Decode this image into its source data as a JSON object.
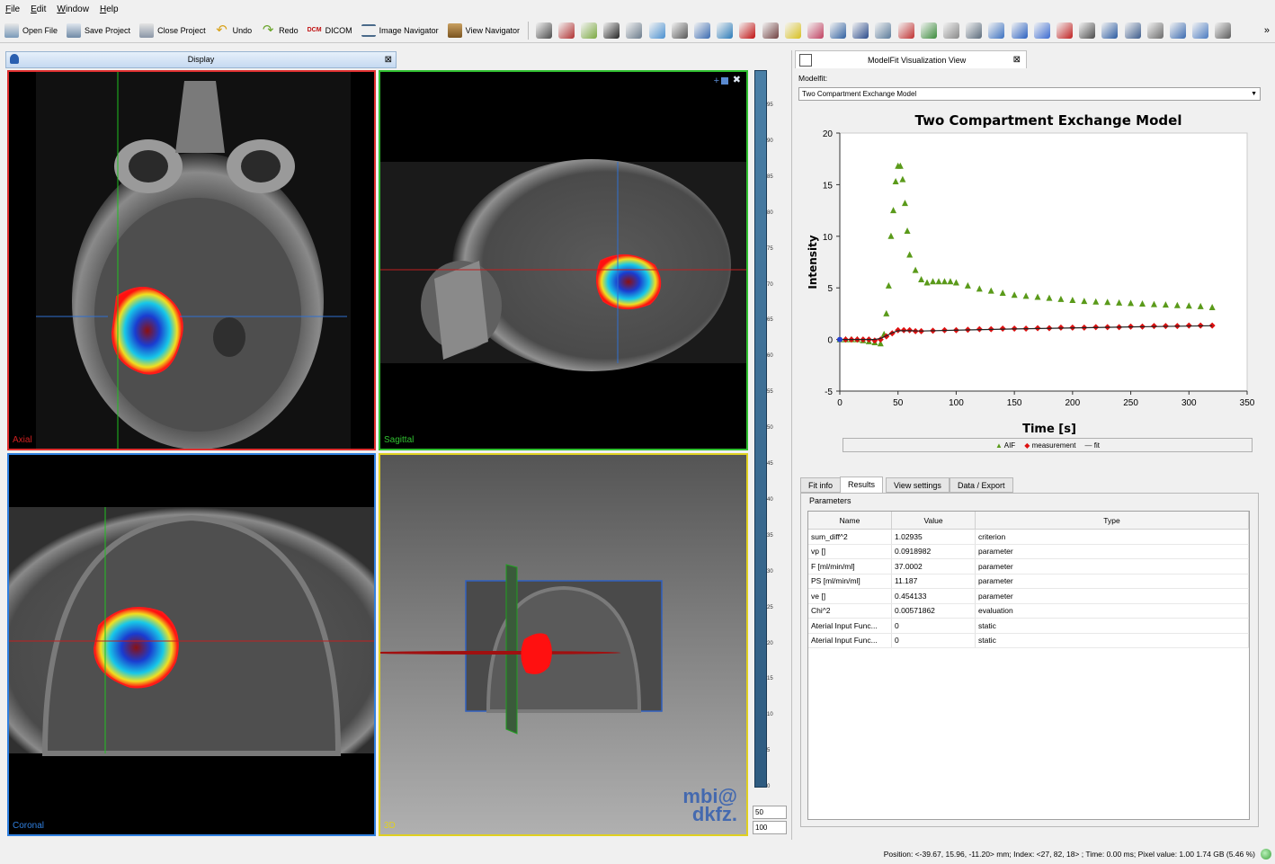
{
  "menubar": [
    "File",
    "Edit",
    "Window",
    "Help"
  ],
  "toolbar": {
    "buttons": [
      {
        "label": "Open File",
        "icon": "open-file-icon"
      },
      {
        "label": "Save Project",
        "icon": "save-project-icon"
      },
      {
        "label": "Close Project",
        "icon": "close-project-icon"
      },
      {
        "label": "Undo",
        "icon": "undo-icon"
      },
      {
        "label": "Redo",
        "icon": "redo-icon"
      },
      {
        "label": "DICOM",
        "icon": "dicom-icon"
      },
      {
        "label": "Image Navigator",
        "icon": "image-navigator-icon"
      },
      {
        "label": "View Navigator",
        "icon": "view-navigator-icon"
      }
    ],
    "plugin_icon_count": 31,
    "overflow": "»"
  },
  "display": {
    "title": "Display",
    "views": {
      "axial": "Axial",
      "sagittal": "Sagittal",
      "coronal": "Coronal",
      "3d": "3D"
    },
    "watermark": [
      "mbi@",
      "dkfz."
    ]
  },
  "levelwindow": {
    "ticks": [
      "95",
      "90",
      "85",
      "80",
      "75",
      "70",
      "65",
      "60",
      "55",
      "50",
      "45",
      "40",
      "35",
      "30",
      "25",
      "20",
      "15",
      "10",
      "5",
      "0"
    ],
    "level": "50",
    "window": "100"
  },
  "modelfit": {
    "tab_title": "ModelFit Visualization View",
    "modelfit_label": "Modelfit:",
    "selected_model": "Two Compartment Exchange Model",
    "tabs": [
      "Fit info",
      "Results",
      "View settings",
      "Data / Export"
    ],
    "active_tab": "Results",
    "params_label": "Parameters",
    "table": {
      "headers": [
        "Name",
        "Value",
        "Type"
      ],
      "rows": [
        [
          "sum_diff^2",
          "1.02935",
          "criterion"
        ],
        [
          "vp []",
          "0.0918982",
          "parameter"
        ],
        [
          "F [ml/min/ml]",
          "37.0002",
          "parameter"
        ],
        [
          "PS [ml/min/ml]",
          "11.187",
          "parameter"
        ],
        [
          "ve []",
          "0.454133",
          "parameter"
        ],
        [
          "Chi^2",
          "0.00571862",
          "evaluation"
        ],
        [
          "Aterial Input Func...",
          "0",
          "static"
        ],
        [
          "Aterial Input Func...",
          "0",
          "static"
        ]
      ]
    }
  },
  "chart_data": {
    "type": "scatter",
    "title": "Two Compartment Exchange Model",
    "xlabel": "Time [s]",
    "ylabel": "Intensity",
    "xlim": [
      0,
      350
    ],
    "ylim": [
      -5,
      20
    ],
    "xticks": [
      "0",
      "50",
      "100",
      "150",
      "200",
      "250",
      "300",
      "350"
    ],
    "yticks": [
      "-5",
      "0",
      "5",
      "10",
      "15",
      "20"
    ],
    "legend_position": "bottom",
    "series": [
      {
        "name": "AIF",
        "color": "#5a9a1a",
        "marker": "triangle",
        "x": [
          0,
          5,
          10,
          15,
          20,
          25,
          30,
          35,
          38,
          40,
          42,
          44,
          46,
          48,
          50,
          52,
          54,
          56,
          58,
          60,
          65,
          70,
          75,
          80,
          85,
          90,
          95,
          100,
          110,
          120,
          130,
          140,
          150,
          160,
          170,
          180,
          190,
          200,
          210,
          220,
          230,
          240,
          250,
          260,
          270,
          280,
          290,
          300,
          310,
          320
        ],
        "y": [
          0,
          0,
          0,
          0,
          -0.1,
          -0.2,
          -0.3,
          -0.4,
          0.5,
          2.5,
          5.2,
          10,
          12.5,
          15.3,
          16.8,
          16.8,
          15.5,
          13.2,
          10.5,
          8.2,
          6.7,
          5.8,
          5.5,
          5.6,
          5.6,
          5.6,
          5.6,
          5.5,
          5.2,
          4.9,
          4.7,
          4.5,
          4.3,
          4.2,
          4.1,
          4.0,
          3.9,
          3.8,
          3.7,
          3.65,
          3.6,
          3.55,
          3.5,
          3.45,
          3.4,
          3.35,
          3.3,
          3.25,
          3.2,
          3.1
        ]
      },
      {
        "name": "measurement",
        "color": "#dd1111",
        "marker": "diamond",
        "x": [
          0,
          5,
          10,
          15,
          20,
          25,
          30,
          35,
          40,
          45,
          50,
          55,
          60,
          65,
          70,
          80,
          90,
          100,
          110,
          120,
          130,
          140,
          150,
          160,
          170,
          180,
          190,
          200,
          210,
          220,
          230,
          240,
          250,
          260,
          270,
          280,
          290,
          300,
          310,
          320
        ],
        "y": [
          0,
          0,
          0,
          0,
          0,
          0,
          -0.1,
          0,
          0.3,
          0.6,
          0.9,
          0.9,
          0.9,
          0.8,
          0.8,
          0.85,
          0.9,
          0.9,
          0.95,
          1.0,
          1.0,
          1.05,
          1.05,
          1.05,
          1.1,
          1.1,
          1.15,
          1.15,
          1.15,
          1.2,
          1.2,
          1.2,
          1.25,
          1.25,
          1.3,
          1.3,
          1.3,
          1.35,
          1.35,
          1.35
        ]
      },
      {
        "name": "fit",
        "color": "#222222",
        "marker": "line",
        "x": [
          0,
          20,
          30,
          35,
          40,
          45,
          50,
          60,
          70,
          100,
          150,
          200,
          250,
          300,
          320
        ],
        "y": [
          0,
          0,
          0,
          0.1,
          0.35,
          0.65,
          0.85,
          0.85,
          0.82,
          0.9,
          1.02,
          1.12,
          1.22,
          1.3,
          1.33
        ]
      }
    ]
  },
  "status": {
    "text": "Position: <-39.67, 15.96, -11.20> mm; Index: <27, 82, 18> ; Time: 0.00 ms; Pixel value: 1.00  1.74 GB (5.46 %)"
  }
}
